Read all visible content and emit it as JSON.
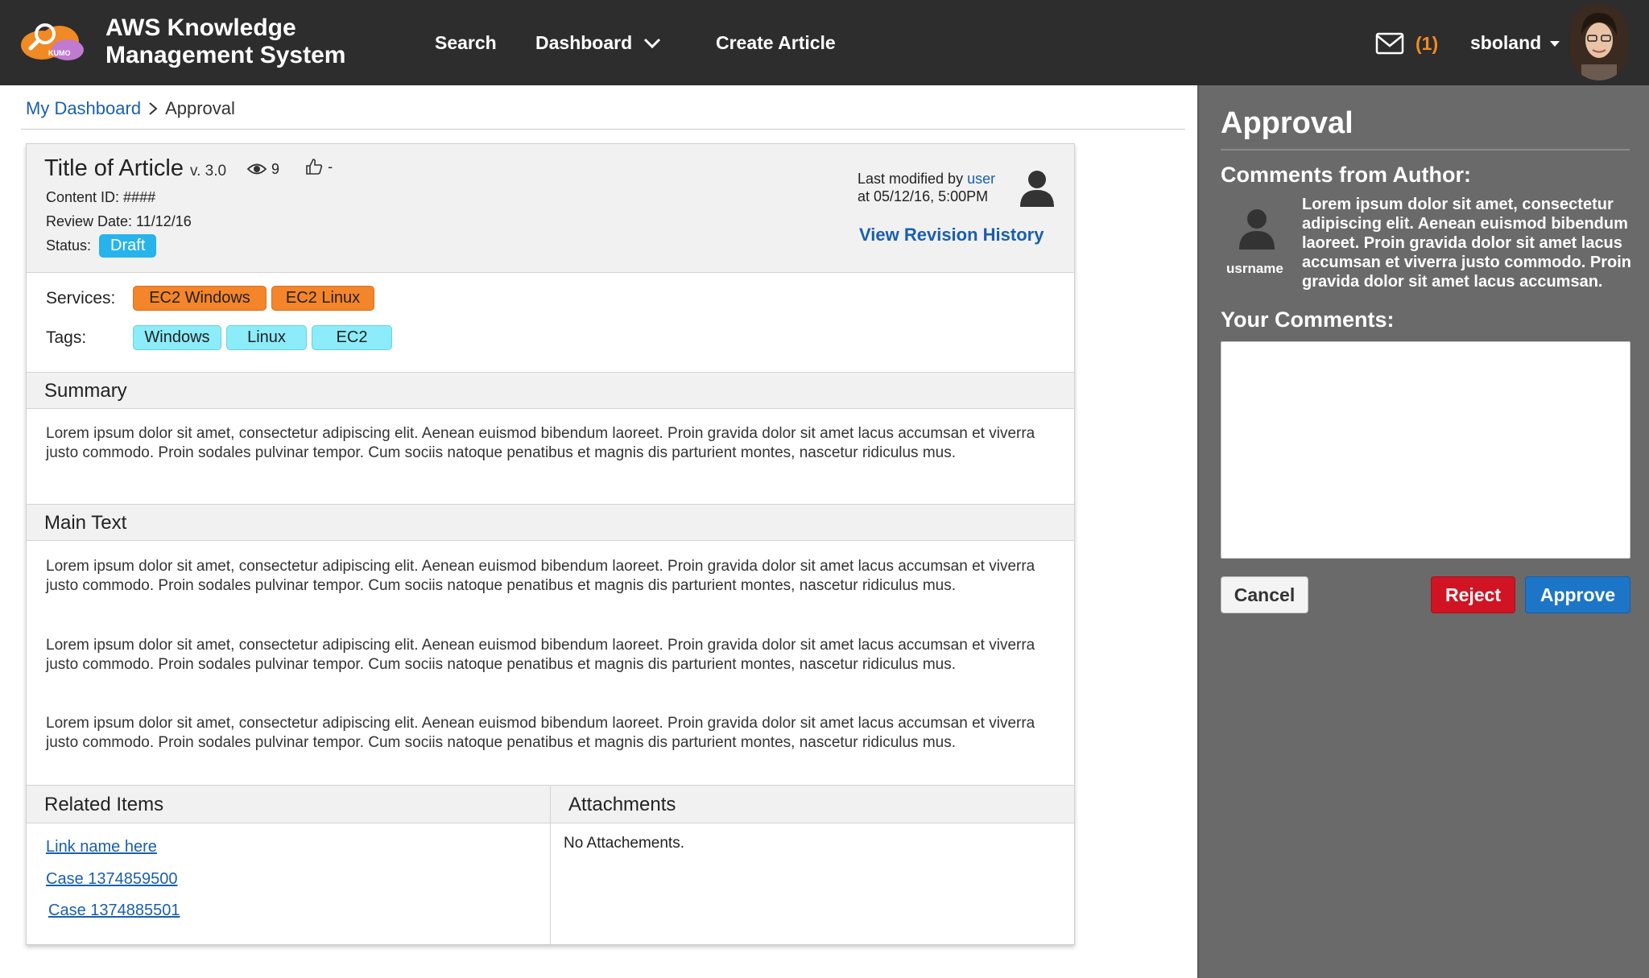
{
  "header": {
    "app_title_line1": "AWS Knowledge",
    "app_title_line2": "Management System",
    "logo_text": "KUMO",
    "nav": {
      "search": "Search",
      "dashboard": "Dashboard",
      "create_article": "Create Article"
    },
    "mail_count": "(1)",
    "username": "sboland"
  },
  "breadcrumb": {
    "home": "My Dashboard",
    "current": "Approval"
  },
  "article": {
    "title": "Title of Article",
    "version": "v. 3.0",
    "views": "9",
    "likes": "-",
    "content_id": "Content ID: ####",
    "review_date": "Review Date: 11/12/16",
    "status_label": "Status:",
    "status_value": "Draft",
    "last_modified_prefix": "Last modified by ",
    "last_modified_user": "user",
    "last_modified_at": "at 05/12/16, 5:00PM",
    "revision_history": "View Revision History",
    "services_label": "Services:",
    "services": [
      "EC2 Windows",
      "EC2 Linux"
    ],
    "tags_label": "Tags:",
    "tags": [
      "Windows",
      "Linux",
      "EC2"
    ],
    "summary_heading": "Summary",
    "summary_text": "Lorem ipsum dolor sit amet, consectetur adipiscing elit. Aenean euismod bibendum laoreet. Proin gravida dolor sit amet lacus accumsan et viverra justo commodo. Proin sodales pulvinar tempor. Cum sociis natoque penatibus et magnis dis parturient montes, nascetur ridiculus mus.",
    "main_heading": "Main Text",
    "main_paragraphs": [
      "Lorem ipsum dolor sit amet, consectetur adipiscing elit. Aenean euismod bibendum laoreet. Proin gravida dolor sit amet lacus accumsan et viverra justo commodo. Proin sodales pulvinar tempor. Cum sociis natoque penatibus et magnis dis parturient montes, nascetur ridiculus mus.",
      "Lorem ipsum dolor sit amet, consectetur adipiscing elit. Aenean euismod bibendum laoreet. Proin gravida dolor sit amet lacus accumsan et viverra justo commodo. Proin sodales pulvinar tempor. Cum sociis natoque penatibus et magnis dis parturient montes, nascetur ridiculus mus.",
      "Lorem ipsum dolor sit amet, consectetur adipiscing elit. Aenean euismod bibendum laoreet. Proin gravida dolor sit amet lacus accumsan et viverra justo commodo. Proin sodales pulvinar tempor. Cum sociis natoque penatibus et magnis dis parturient montes, nascetur ridiculus mus."
    ],
    "related_heading": "Related Items",
    "related_links": [
      "Link name here",
      "Case 1374859500",
      "Case 1374885501"
    ],
    "attachments_heading": "Attachments",
    "attachments_empty": "No Attachements."
  },
  "approval": {
    "title": "Approval",
    "author_comments_heading": "Comments from Author:",
    "author_name": "usrname",
    "author_comment": "Lorem ipsum dolor sit amet, consectetur adipiscing elit. Aenean euismod bibendum laoreet. Proin gravida dolor sit amet lacus accumsan et viverra justo commodo. Proin gravida dolor sit amet lacus accumsan.",
    "your_comments_heading": "Your Comments:",
    "your_comments_value": "",
    "cancel": "Cancel",
    "reject": "Reject",
    "approve": "Approve"
  },
  "colors": {
    "topbar": "#2d2d2d",
    "accent_orange": "#f5852a",
    "link_blue": "#1a5fad",
    "draft_badge": "#27b3ec",
    "tag_cyan": "#8cecfa",
    "panel_gray": "#6a6a6a",
    "reject_red": "#d01424",
    "approve_blue": "#1d75c8"
  },
  "icons": [
    "kumo-cloud-logo",
    "chevron-down-icon",
    "mail-icon",
    "caret-down-icon",
    "eye-icon",
    "thumbs-up-icon",
    "user-silhouette-icon"
  ]
}
